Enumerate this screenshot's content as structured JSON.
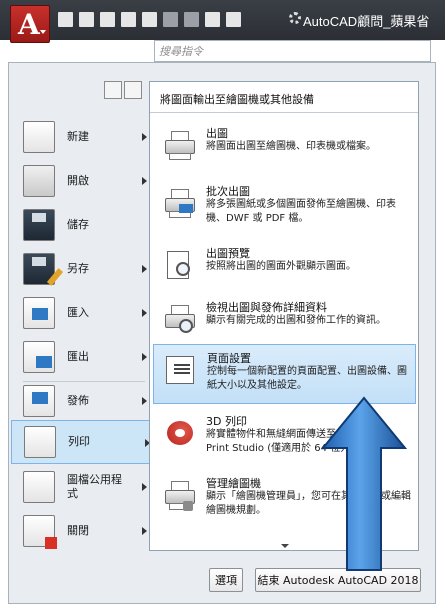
{
  "titlebar": {
    "title": "AutoCAD顧問_蘋果省",
    "app_button_icon": "autocad-a-logo",
    "quick_access": [
      "new-icon",
      "open-icon",
      "save-icon",
      "saveas-icon",
      "print-icon",
      "undo-icon",
      "redo-icon",
      "plot-icon",
      "preview-icon"
    ]
  },
  "search": {
    "placeholder": "搜尋指令"
  },
  "left_menu": {
    "items": [
      {
        "label": "新建",
        "icon": "new-document-icon",
        "has_submenu": true
      },
      {
        "label": "開啟",
        "icon": "open-folder-icon",
        "has_submenu": true
      },
      {
        "label": "儲存",
        "icon": "save-floppy-icon",
        "has_submenu": false
      },
      {
        "label": "另存",
        "icon": "save-as-icon",
        "has_submenu": true
      },
      {
        "label": "匯入",
        "icon": "import-icon",
        "has_submenu": true
      },
      {
        "label": "匯出",
        "icon": "export-icon",
        "has_submenu": true
      },
      {
        "label": "發佈",
        "icon": "publish-icon",
        "has_submenu": true
      },
      {
        "label": "列印",
        "icon": "print-icon",
        "has_submenu": true,
        "active": true
      },
      {
        "label": "圖檔公用程式",
        "icon": "drawing-utilities-icon",
        "has_submenu": true
      },
      {
        "label": "關閉",
        "icon": "close-document-icon",
        "has_submenu": true
      }
    ]
  },
  "print_panel": {
    "heading": "將圖面輸出至繪圖機或其他設備",
    "options": [
      {
        "title": "出圖",
        "desc": "將圖面出圖至繪圖機、印表機或檔案。",
        "icon": "plot-icon"
      },
      {
        "title": "批次出圖",
        "desc": "將多張圖紙或多個圖面發佈至繪圖機、印表機、DWF 或 PDF 檔。",
        "icon": "batch-plot-icon"
      },
      {
        "title": "出圖預覽",
        "desc": "按照將出圖的圖面外觀顯示圖面。",
        "icon": "plot-preview-icon"
      },
      {
        "title": "檢視出圖與發佈詳細資料",
        "desc": "顯示有關完成的出圖和發佈工作的資訊。",
        "icon": "plot-details-icon"
      },
      {
        "title": "頁面設置",
        "desc": "控制每一個新配置的頁面配置、出圖設備、圖紙大小以及其他設定。",
        "icon": "page-setup-icon",
        "active": true
      },
      {
        "title": "3D 列印",
        "desc": "將實體物件和無縫網面傳送至 Autodesk Print Studio (僅適用於 64 位元)。",
        "icon": "3d-print-icon"
      },
      {
        "title": "管理繪圖機",
        "desc": "顯示「繪圖機管理員」，您可在其中加入或編輯繪圖機規劃。",
        "icon": "manage-plotters-icon"
      }
    ]
  },
  "footer": {
    "options_label": "選項",
    "exit_label": "結束 Autodesk AutoCAD 2018"
  }
}
